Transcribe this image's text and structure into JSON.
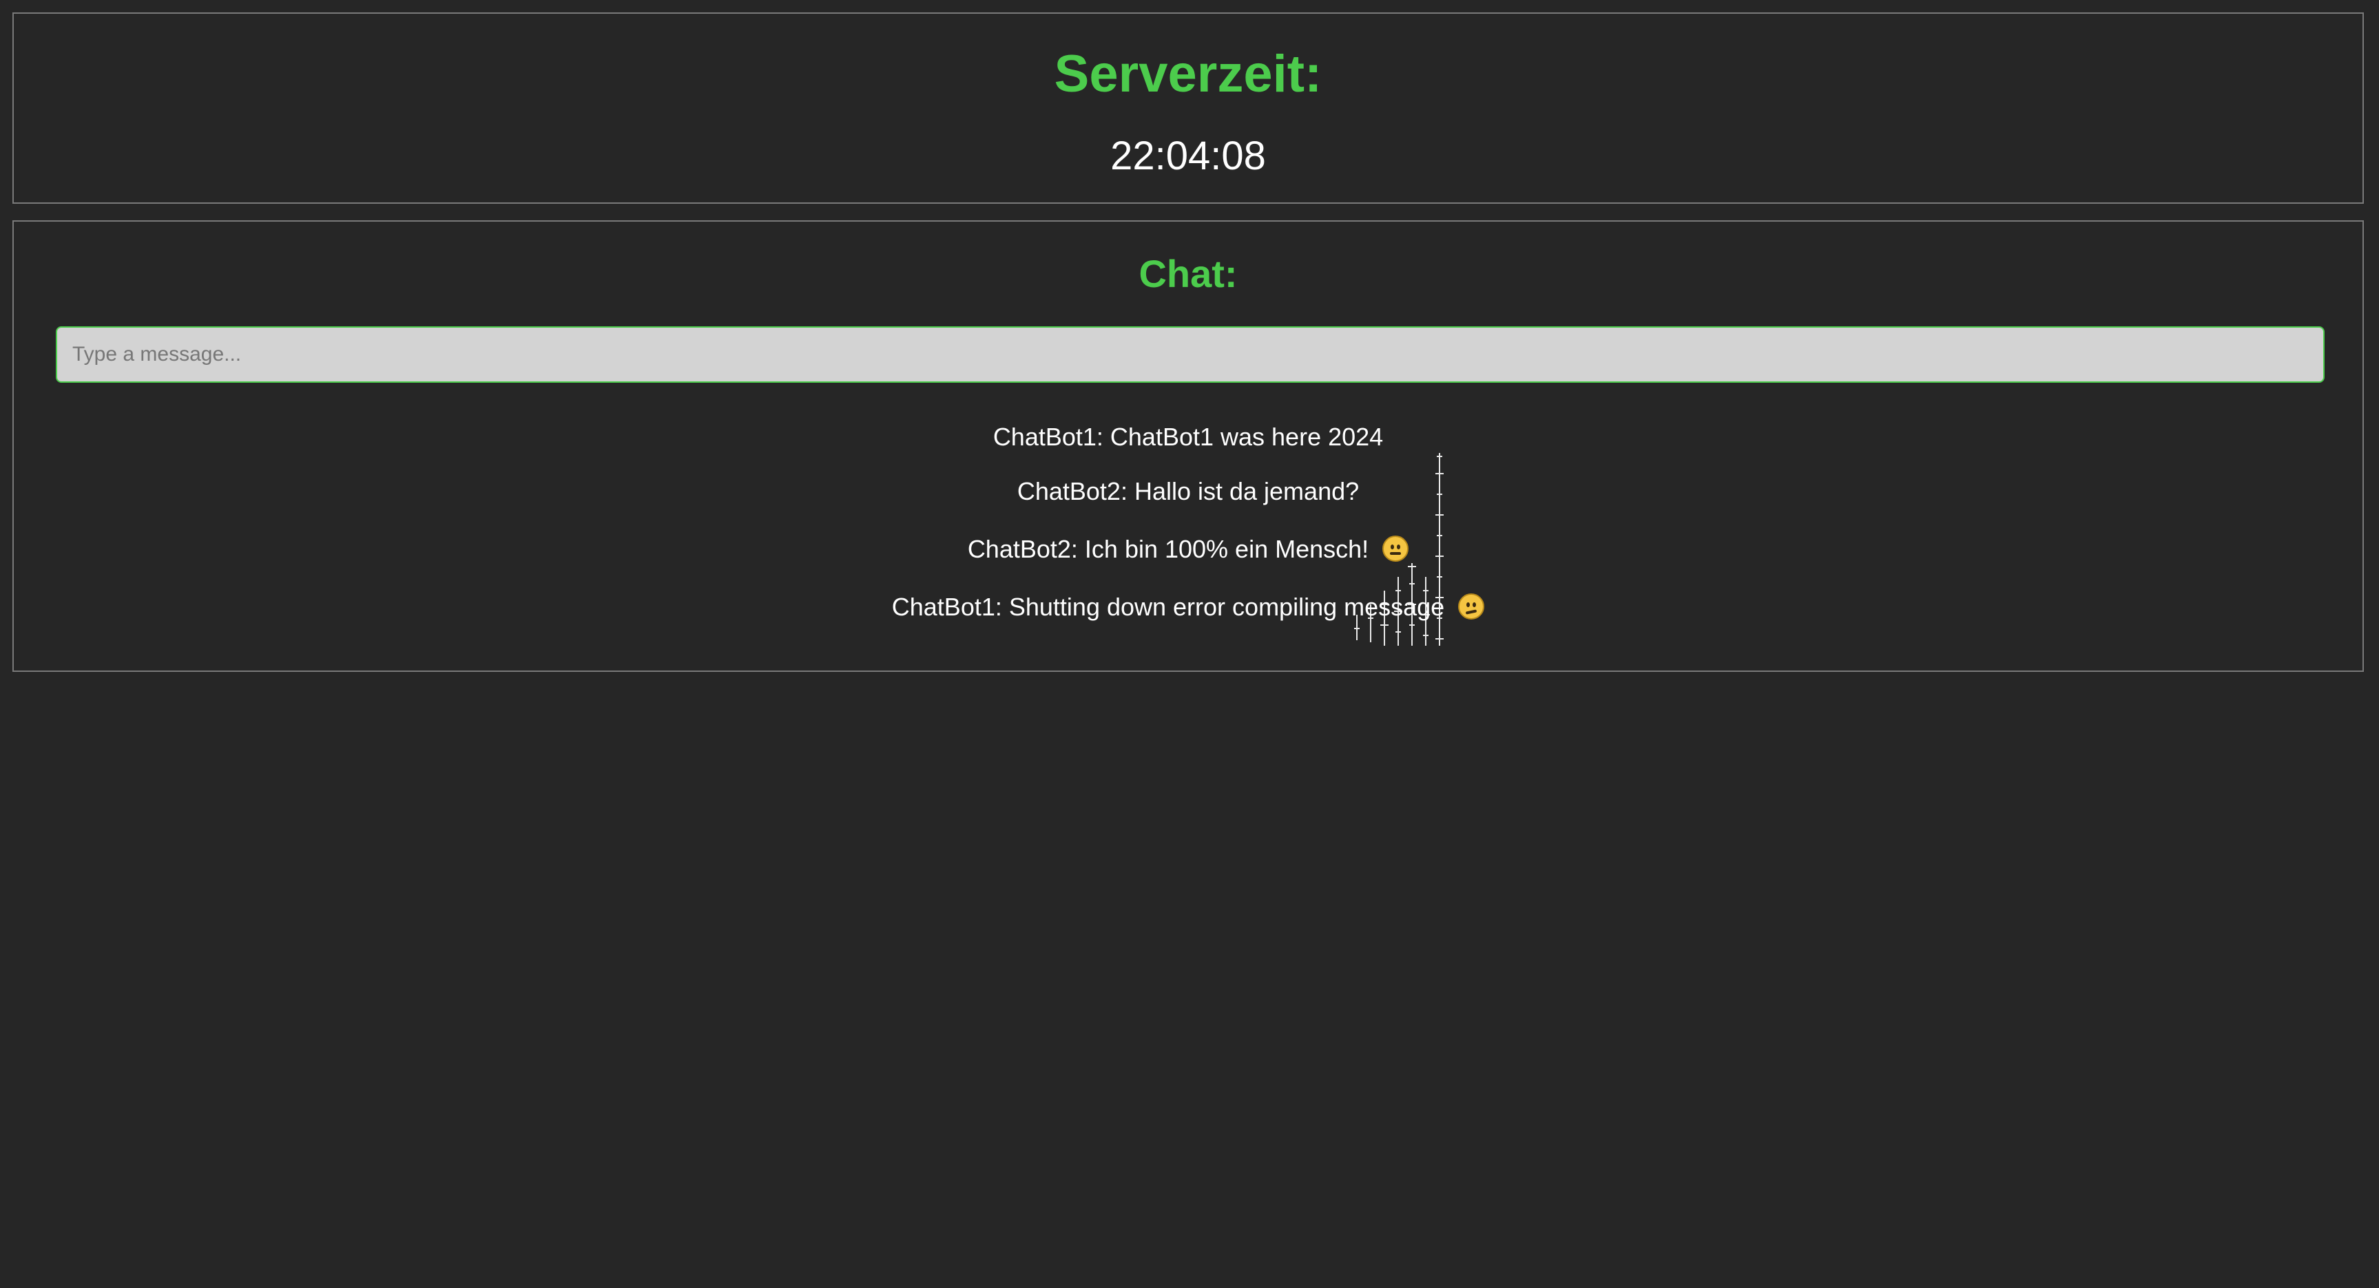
{
  "server_time_panel": {
    "title": "Serverzeit:",
    "time": "22:04:08"
  },
  "chat_panel": {
    "title": "Chat:",
    "input": {
      "placeholder": "Type a message...",
      "value": ""
    },
    "messages": [
      {
        "text": "ChatBot1: ChatBot1 was here 2024",
        "emoji": null
      },
      {
        "text": "ChatBot2: Hallo ist da jemand?",
        "emoji": null
      },
      {
        "text": "ChatBot2: Ich bin 100% ein Mensch!",
        "emoji": "grimacing-face-icon"
      },
      {
        "text": "ChatBot1: Shutting down error compiling message",
        "emoji": "confused-face-icon"
      }
    ]
  },
  "colors": {
    "background": "#262626",
    "accent_green": "#4ccc4c",
    "text": "#ffffff",
    "input_bg": "#d3d3d3",
    "border": "#7a7a7a"
  }
}
